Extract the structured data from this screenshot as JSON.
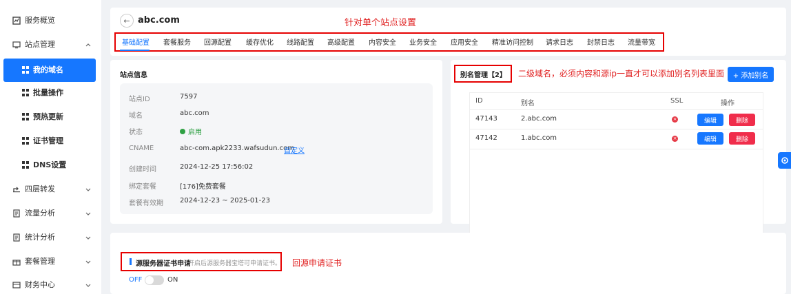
{
  "sidebar": {
    "items": [
      {
        "label": "服务概览",
        "icon": "chart-icon"
      },
      {
        "label": "站点管理",
        "icon": "site-icon"
      },
      {
        "label": "我的域名",
        "icon": "grid-icon"
      },
      {
        "label": "批量操作",
        "icon": "grid-icon"
      },
      {
        "label": "预热更新",
        "icon": "grid-icon"
      },
      {
        "label": "证书管理",
        "icon": "grid-icon"
      },
      {
        "label": "DNS设置",
        "icon": "grid-icon"
      },
      {
        "label": "四层转发",
        "icon": "forward-icon"
      },
      {
        "label": "流量分析",
        "icon": "document-icon"
      },
      {
        "label": "统计分析",
        "icon": "document-icon"
      },
      {
        "label": "套餐管理",
        "icon": "gift-icon"
      },
      {
        "label": "财务中心",
        "icon": "wallet-icon"
      }
    ]
  },
  "header": {
    "back_icon": "back-arrow-icon",
    "domain": "abc.com",
    "annotation": "针对单个站点设置"
  },
  "tabs": [
    "基础配置",
    "套餐服务",
    "回源配置",
    "缓存优化",
    "线路配置",
    "高级配置",
    "内容安全",
    "业务安全",
    "应用安全",
    "精准访问控制",
    "请求日志",
    "封禁日志",
    "流量带宽"
  ],
  "site_info": {
    "title": "站点信息",
    "rows": [
      {
        "label": "站点ID",
        "value": "7597"
      },
      {
        "label": "域名",
        "value": "abc.com"
      },
      {
        "label": "状态",
        "value": "启用"
      },
      {
        "label": "CNAME",
        "value": "abc-com.apk2233.wafsudun.com",
        "link": "自定义"
      },
      {
        "label": "创建时间",
        "value": "2024-12-25 17:56:02"
      },
      {
        "label": "绑定套餐",
        "value": "[176]免费套餐"
      },
      {
        "label": "套餐有效期",
        "value": "2024-12-23 ~ 2025-01-23"
      }
    ]
  },
  "alias": {
    "title": "别名管理【2】",
    "annotation": "二级域名，必须内容和源ip一直才可以添加别名列表里面",
    "add_button": "+ 添加别名",
    "columns": [
      "ID",
      "别名",
      "SSL",
      "操作"
    ],
    "rows": [
      {
        "id": "47143",
        "alias": "2.abc.com",
        "edit": "编辑",
        "delete": "删除"
      },
      {
        "id": "47142",
        "alias": "1.abc.com",
        "edit": "编辑",
        "delete": "删除"
      }
    ]
  },
  "origin_cert": {
    "title": "源服务器证书申请",
    "hint": "开启后源服务器宝塔可申请证书。",
    "annotation": "回源申请证书",
    "off_label": "OFF",
    "on_label": "ON"
  },
  "colors": {
    "accent": "#1677ff",
    "danger": "#f02d4b",
    "annotation": "#e02020",
    "success": "#2ea043"
  }
}
